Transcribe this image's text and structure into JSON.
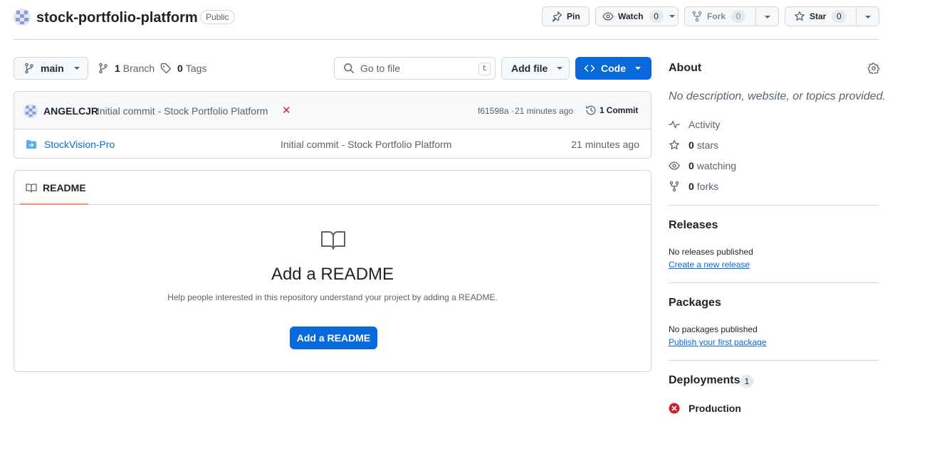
{
  "repo": {
    "name": "stock-portfolio-platform",
    "visibility": "Public"
  },
  "actions": {
    "pin_label": "Pin",
    "watch_label": "Watch",
    "watch_count": "0",
    "fork_label": "Fork",
    "fork_count": "0",
    "star_label": "Star",
    "star_count": "0"
  },
  "toolbar": {
    "branch_name": "main",
    "branch_count": "1",
    "branch_label": "Branch",
    "tag_count": "0",
    "tag_label": "Tags",
    "search_placeholder": "Go to file",
    "search_shortcut": "t",
    "add_file_label": "Add file",
    "code_label": "Code"
  },
  "latest_commit": {
    "author": "ANGELCJR",
    "message": "Initial commit - Stock Portfolio Platform",
    "status_mark": "✕",
    "hash": "f61598a",
    "time": "21 minutes ago",
    "commit_count": "1",
    "commit_label": "Commit"
  },
  "files": [
    {
      "name": "StockVision-Pro",
      "message": "Initial commit - Stock Portfolio Platform",
      "time": "21 minutes ago"
    }
  ],
  "readme": {
    "tab_label": "README",
    "title": "Add a README",
    "description": "Help people interested in this repository understand your project by adding a README.",
    "button_label": "Add a README"
  },
  "about": {
    "heading": "About",
    "description": "No description, website, or topics provided.",
    "activity_label": "Activity",
    "stars_count": "0",
    "stars_label": "stars",
    "watching_count": "0",
    "watching_label": "watching",
    "forks_count": "0",
    "forks_label": "forks"
  },
  "releases": {
    "heading": "Releases",
    "status": "No releases published",
    "link": "Create a new release"
  },
  "packages": {
    "heading": "Packages",
    "status": "No packages published",
    "link": "Publish your first package"
  },
  "deployments": {
    "heading": "Deployments",
    "count": "1",
    "items": [
      {
        "name": "Production",
        "status": "failed"
      }
    ]
  },
  "colors": {
    "accent_blue": "#0969da",
    "failure_red": "#cf222e",
    "folder_blue": "#54aeff",
    "tab_underline": "#fd8c73"
  }
}
